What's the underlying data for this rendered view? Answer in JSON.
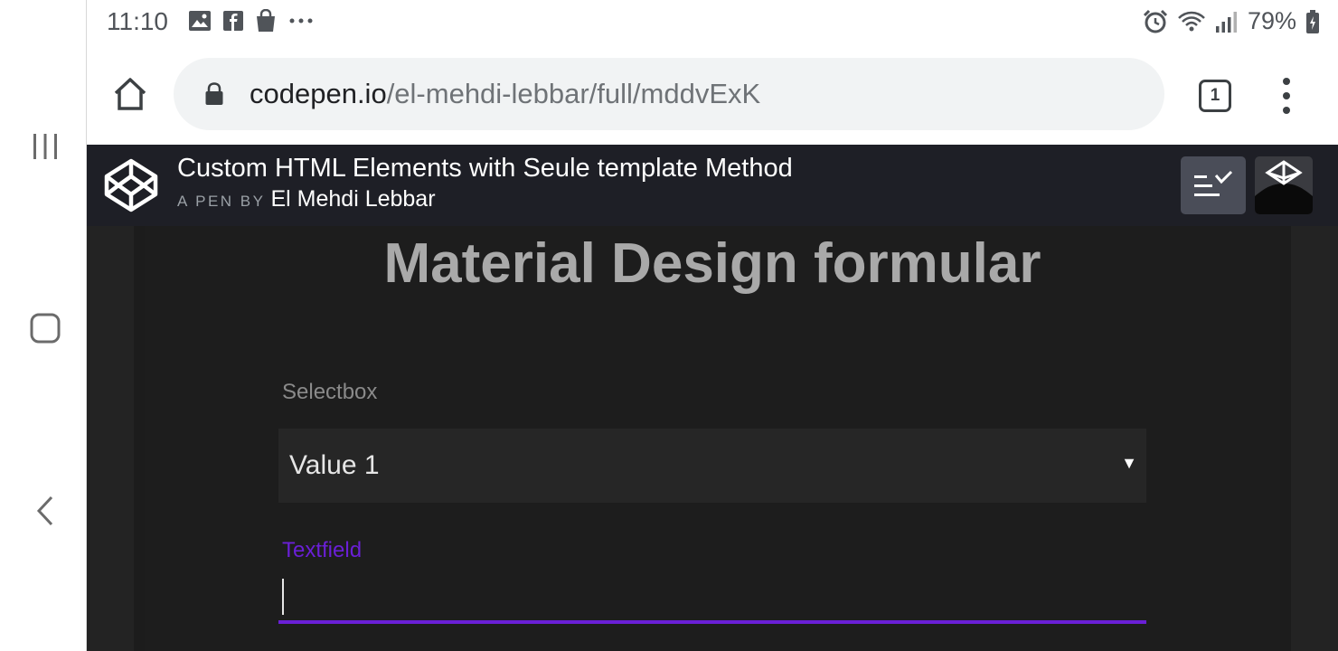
{
  "status_bar": {
    "time": "11:10",
    "left_icons": [
      "gallery-icon",
      "facebook-icon",
      "shopping-bag-icon",
      "more-notifications-icon"
    ],
    "right_icons": [
      "alarm-icon",
      "wifi-icon",
      "signal-icon",
      "battery-icon"
    ],
    "battery_percent": "79%"
  },
  "browser": {
    "url_domain": "codepen.io",
    "url_path": "/el-mehdi-lebbar/full/mddvExK",
    "tab_count": "1"
  },
  "pen_header": {
    "title": "Custom HTML Elements with Seule template Method",
    "by_label": "A PEN BY",
    "author": "El Mehdi Lebbar"
  },
  "page": {
    "heading": "Material Design formular",
    "selectbox_label": "Selectbox",
    "selectbox_value": "Value 1",
    "textfield_label": "Textfield",
    "textfield_value": ""
  },
  "colors": {
    "accent": "#6a1fd6",
    "header_bg": "#1e1f26",
    "page_bg": "#1d1d1d"
  }
}
